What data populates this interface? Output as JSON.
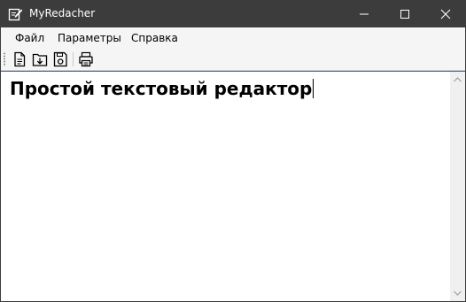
{
  "window": {
    "title": "MyRedacher",
    "icons": {
      "app": "notepad-pencil-icon",
      "minimize": "minimize-icon",
      "maximize": "maximize-icon",
      "close": "close-icon"
    },
    "titlebar_color": "#3c3c3c"
  },
  "menu": {
    "items": [
      {
        "label": "Файл"
      },
      {
        "label": "Параметры"
      },
      {
        "label": "Справка"
      }
    ]
  },
  "toolbar": {
    "buttons": [
      {
        "icon": "new-file-icon"
      },
      {
        "icon": "open-file-icon"
      },
      {
        "icon": "save-file-icon"
      },
      {
        "icon": "print-icon"
      }
    ]
  },
  "editor": {
    "content": "Простой текстовый редактор",
    "focus_color": "#2b6fc4"
  }
}
